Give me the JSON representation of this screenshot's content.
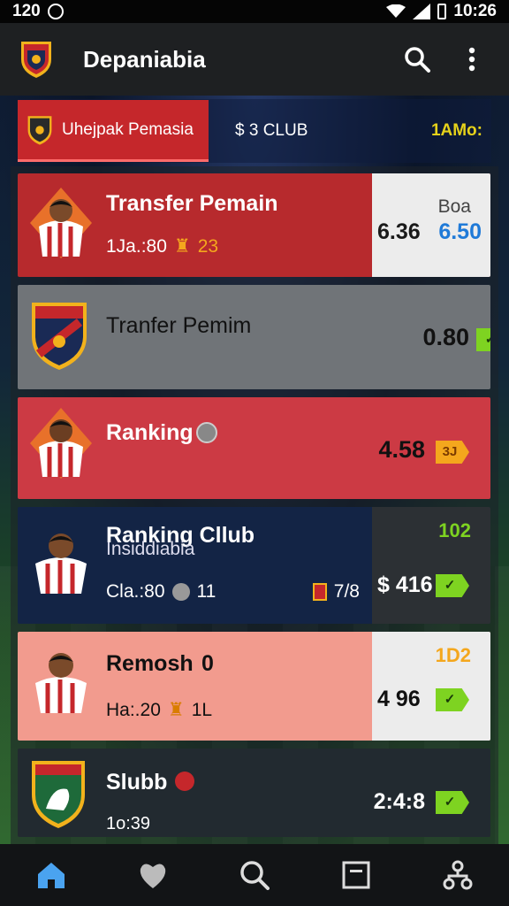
{
  "status": {
    "time_left": "120",
    "time_right": "10:26"
  },
  "appbar": {
    "title": "Depaniabia"
  },
  "tabs": {
    "active": "Uhejpak Pemasia",
    "second": "$ 3 CLUB",
    "right": "1AMo:"
  },
  "cards": [
    {
      "title": "Transfer Pemain",
      "meta1": "1Ja.:80",
      "meta2": "23",
      "score_label": "Boa",
      "score_a": "6.36",
      "score_b": "6.50",
      "bg": "#b72a2d",
      "aside_bg": "#ececec"
    },
    {
      "title": "Tranfer Pemim",
      "score": "0.80",
      "tag": "✓",
      "bg": "#707478"
    },
    {
      "title": "Ranking",
      "score": "4.58",
      "tag": "3J",
      "bg": "#cc3a44"
    },
    {
      "title": "Ranking Cllub",
      "subtitle": "Insiddiabia",
      "meta1": "Cla.:80",
      "meta2": "11",
      "meta3": "7/8",
      "top_num": "102",
      "score": "$ 416",
      "tag": "✓",
      "bg": "#132445",
      "aside_bg": "#2c3034"
    },
    {
      "title": "Remosh",
      "title_suffix": "0",
      "meta1": "Ha:.20",
      "meta2": "1L",
      "top_num": "1D2",
      "score": "4 96",
      "tag": "✓",
      "bg": "#f29b8e",
      "aside_bg": "#ececec"
    },
    {
      "title": "Slubb",
      "meta1": "1o:39",
      "score": "2:4:8",
      "tag": "✓",
      "bg": "#222a30"
    }
  ],
  "colors": {
    "accent_red": "#c5272b",
    "accent_green": "#7ed321",
    "accent_orange": "#f4a71d",
    "appbar": "#1e2022"
  },
  "icons": [
    "home-icon",
    "heart-icon",
    "search-icon",
    "square-icon",
    "network-icon"
  ]
}
